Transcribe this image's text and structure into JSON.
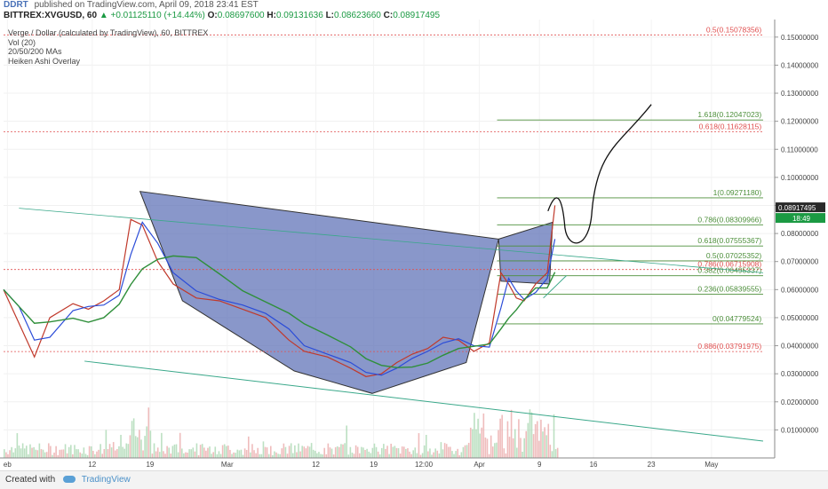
{
  "header": {
    "brand": "DDRT",
    "published": "published on TradingView.com, April 09, 2018 23:41 EST"
  },
  "ticker": {
    "symbol": "BITTREX:XVGUSD, 60",
    "change": "▲ +0.01125110 (+14.44%)",
    "open_label": "O:",
    "open": "0.08697600",
    "high_label": "H:",
    "high": "0.09131636",
    "low_label": "L:",
    "low": "0.08623660",
    "close_label": "C:",
    "close": "0.08917495"
  },
  "legend": {
    "title": "Verge / Dollar (calculated by TradingView), 60, BITTREX",
    "vol": "Vol (20)",
    "ma": "20/50/200 MAs",
    "heiken": "Heiken Ashi Overlay"
  },
  "footer": {
    "created": "Created with",
    "brand": "TradingView"
  },
  "colors": {
    "pattern_fill": "#5b6fb5",
    "fib_green": "#4c8f3a",
    "fib_red": "#e05050",
    "price_label_bg": "#2a2a2a",
    "price_label_green": "#1b9a43",
    "ma_blue": "#2b4cd8",
    "ma_green": "#2f8f3a",
    "candle_red": "#c0392b",
    "trend_teal": "#3aa88a"
  },
  "chart_data": {
    "type": "line",
    "y_axis_range": [
      0.0,
      0.155
    ],
    "y_ticks": [
      "0.15000000",
      "0.14000000",
      "0.13000000",
      "0.12000000",
      "0.11000000",
      "0.10000000",
      "0.09000000",
      "0.08000000",
      "0.07000000",
      "0.06000000",
      "0.05000000",
      "0.04000000",
      "0.03000000",
      "0.02000000",
      "0.01000000"
    ],
    "x_ticks": [
      "eb",
      "12",
      "19",
      "Mar",
      "12",
      "19",
      "12:00",
      "Apr",
      "9",
      "16",
      "23",
      "May"
    ],
    "current_price": "0.08917495",
    "current_time": "18:49",
    "price_path": [
      [
        0.0,
        0.06
      ],
      [
        0.02,
        0.048
      ],
      [
        0.04,
        0.036
      ],
      [
        0.06,
        0.05
      ],
      [
        0.09,
        0.055
      ],
      [
        0.11,
        0.053
      ],
      [
        0.13,
        0.056
      ],
      [
        0.15,
        0.06
      ],
      [
        0.165,
        0.085
      ],
      [
        0.18,
        0.083
      ],
      [
        0.2,
        0.07
      ],
      [
        0.22,
        0.062
      ],
      [
        0.25,
        0.057
      ],
      [
        0.28,
        0.056
      ],
      [
        0.31,
        0.053
      ],
      [
        0.34,
        0.05
      ],
      [
        0.37,
        0.042
      ],
      [
        0.39,
        0.038
      ],
      [
        0.42,
        0.036
      ],
      [
        0.45,
        0.032
      ],
      [
        0.47,
        0.029
      ],
      [
        0.49,
        0.03
      ],
      [
        0.51,
        0.034
      ],
      [
        0.53,
        0.037
      ],
      [
        0.55,
        0.039
      ],
      [
        0.57,
        0.043
      ],
      [
        0.59,
        0.042
      ],
      [
        0.61,
        0.038
      ],
      [
        0.63,
        0.041
      ],
      [
        0.645,
        0.066
      ],
      [
        0.655,
        0.062
      ],
      [
        0.665,
        0.057
      ],
      [
        0.675,
        0.056
      ],
      [
        0.69,
        0.062
      ],
      [
        0.705,
        0.066
      ],
      [
        0.715,
        0.09
      ]
    ],
    "pattern_points": {
      "X": [
        0.177,
        0.095
      ],
      "A": [
        0.232,
        0.056
      ],
      "B": [
        0.377,
        0.031
      ],
      "C": [
        0.478,
        0.023
      ],
      "D": [
        0.6,
        0.034
      ],
      "E": [
        0.642,
        0.078
      ],
      "F": [
        0.708,
        0.062
      ]
    },
    "fib_levels": [
      {
        "label": "0.5(0.15078356)",
        "value": 0.15078356,
        "color": "red"
      },
      {
        "label": "1.618(0.12047023)",
        "value": 0.12047023,
        "color": "green"
      },
      {
        "label": "0.618(0.11628115)",
        "value": 0.11628115,
        "color": "red"
      },
      {
        "label": "1(0.09271180)",
        "value": 0.0927118,
        "color": "green"
      },
      {
        "label": "0.786(0.08309966)",
        "value": 0.08309966,
        "color": "green"
      },
      {
        "label": "0.618(0.07555367)",
        "value": 0.07555367,
        "color": "green"
      },
      {
        "label": "0.5(0.07025352)",
        "value": 0.07025352,
        "color": "green"
      },
      {
        "label": "0.786(0.06715908)",
        "value": 0.06715908,
        "color": "red"
      },
      {
        "label": "0.382(0.06495337)",
        "value": 0.06495337,
        "color": "green"
      },
      {
        "label": "0.236(0.05839555)",
        "value": 0.05839555,
        "color": "green"
      },
      {
        "label": "0(0.04779524)",
        "value": 0.04779524,
        "color": "green"
      },
      {
        "label": "0.886(0.03791975)",
        "value": 0.03791975,
        "color": "red"
      }
    ]
  }
}
